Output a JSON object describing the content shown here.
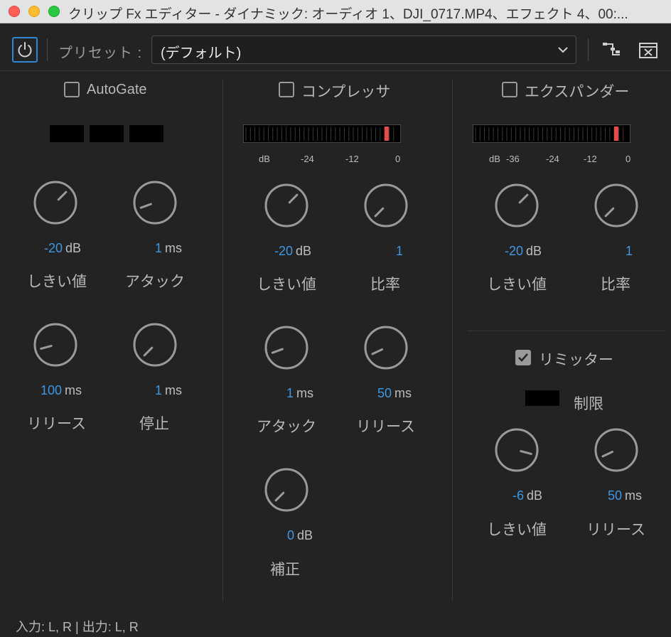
{
  "window": {
    "title": "クリップ Fx エディター - ダイナミック: オーディオ 1、DJI_0717.MP4、エフェクト 4、00:..."
  },
  "toolbar": {
    "preset_label": "プリセット :",
    "preset_value": "(デフォルト)"
  },
  "autogate": {
    "label": "AutoGate",
    "checked": false,
    "knobs": [
      {
        "num": "-20",
        "unit": "dB",
        "label": "しきい値"
      },
      {
        "num": "1",
        "unit": "ms",
        "label": "アタック"
      },
      {
        "num": "100",
        "unit": "ms",
        "label": "リリース"
      },
      {
        "num": "1",
        "unit": "ms",
        "label": "停止"
      }
    ]
  },
  "compressor": {
    "label": "コンプレッサ",
    "checked": false,
    "meter_ticks": [
      "dB",
      "-24",
      "-12",
      "0"
    ],
    "knobs": [
      {
        "num": "-20",
        "unit": "dB",
        "label": "しきい値"
      },
      {
        "num": "1",
        "unit": "",
        "label": "比率"
      },
      {
        "num": "1",
        "unit": "ms",
        "label": "アタック"
      },
      {
        "num": "50",
        "unit": "ms",
        "label": "リリース"
      },
      {
        "num": "0",
        "unit": "dB",
        "label": "補正"
      }
    ]
  },
  "expander": {
    "label": "エクスパンダー",
    "checked": false,
    "meter_ticks": [
      "dB",
      "-36",
      "-24",
      "-12",
      "0"
    ],
    "knobs": [
      {
        "num": "-20",
        "unit": "dB",
        "label": "しきい値"
      },
      {
        "num": "1",
        "unit": "",
        "label": "比率"
      }
    ]
  },
  "limiter": {
    "label": "リミッター",
    "checked": true,
    "limit_label": "制限",
    "knobs": [
      {
        "num": "-6",
        "unit": "dB",
        "label": "しきい値"
      },
      {
        "num": "50",
        "unit": "ms",
        "label": "リリース"
      }
    ]
  },
  "footer": {
    "io_text": "入力: L, R | 出力: L, R"
  },
  "colors": {
    "accent": "#3d97e2",
    "meter_peak": "#e94b4b",
    "background": "#232323"
  }
}
